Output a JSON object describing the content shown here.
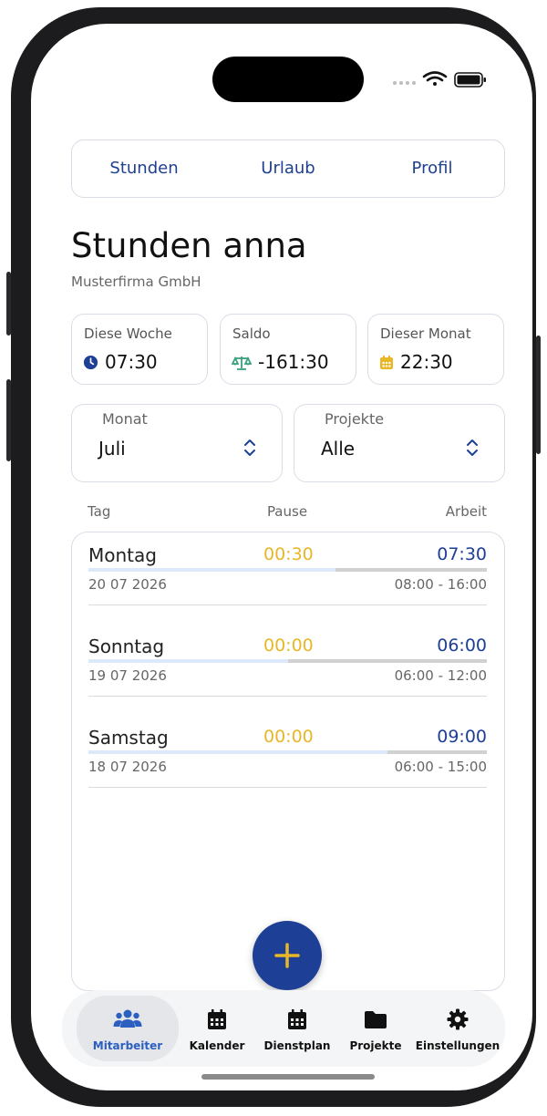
{
  "tabs": [
    {
      "label": "Stunden",
      "active": true
    },
    {
      "label": "Urlaub",
      "active": false
    },
    {
      "label": "Profil",
      "active": false
    }
  ],
  "page": {
    "title": "Stunden anna",
    "company": "Musterfirma GmbH"
  },
  "stats": [
    {
      "label": "Diese Woche",
      "value": "07:30",
      "icon": "clock-icon",
      "color": "#1d3f96"
    },
    {
      "label": "Saldo",
      "value": "-161:30",
      "icon": "balance-scale-icon",
      "color": "#3aa17e"
    },
    {
      "label": "Dieser Monat",
      "value": "22:30",
      "icon": "calendar-icon",
      "color": "#e8b728"
    }
  ],
  "filters": {
    "month": {
      "label": "Monat",
      "value": "Juli"
    },
    "project": {
      "label": "Projekte",
      "value": "Alle"
    }
  },
  "columns": {
    "day": "Tag",
    "pause": "Pause",
    "work": "Arbeit"
  },
  "entries": [
    {
      "day": "Montag",
      "date": "20 07 2026",
      "pause": "00:30",
      "work": "07:30",
      "range": "08:00 - 16:00",
      "progress": 0.62
    },
    {
      "day": "Sonntag",
      "date": "19 07 2026",
      "pause": "00:00",
      "work": "06:00",
      "range": "06:00 - 12:00",
      "progress": 0.5
    },
    {
      "day": "Samstag",
      "date": "18 07 2026",
      "pause": "00:00",
      "work": "09:00",
      "range": "06:00 - 15:00",
      "progress": 0.75
    }
  ],
  "fab_icon": "plus-icon",
  "nav": [
    {
      "label": "Mitarbeiter",
      "icon": "users-icon",
      "active": true
    },
    {
      "label": "Kalender",
      "icon": "calendar-icon",
      "active": false
    },
    {
      "label": "Dienstplan",
      "icon": "calendar-grid-icon",
      "active": false
    },
    {
      "label": "Projekte",
      "icon": "folder-icon",
      "active": false
    },
    {
      "label": "Einstellungen",
      "icon": "gear-icon",
      "active": false
    }
  ],
  "colors": {
    "accent": "#1d3f96",
    "pause": "#e8b728",
    "active_nav": "#2b5fc0"
  }
}
